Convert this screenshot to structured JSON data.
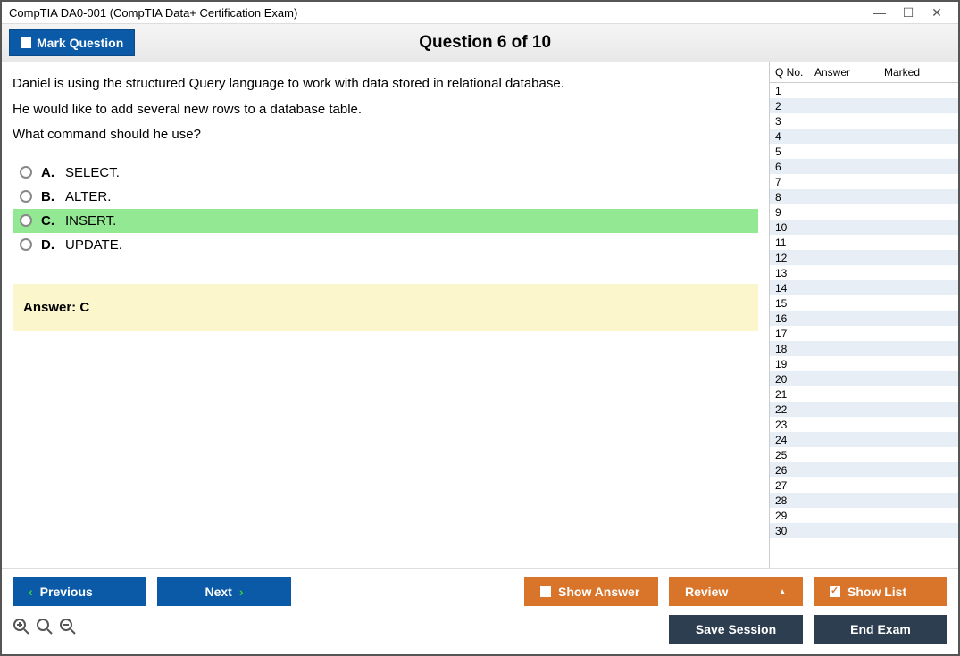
{
  "title": "CompTIA DA0-001 (CompTIA Data+ Certification Exam)",
  "header": {
    "mark_label": "Mark Question",
    "question_title": "Question 6 of 10"
  },
  "question": {
    "text": "Daniel is using the structured Query language to work with data stored in relational database.\nHe would like to add several new rows to a database table.\nWhat command should he use?",
    "options": [
      {
        "letter": "A.",
        "text": "SELECT.",
        "highlighted": false
      },
      {
        "letter": "B.",
        "text": "ALTER.",
        "highlighted": false
      },
      {
        "letter": "C.",
        "text": "INSERT.",
        "highlighted": true
      },
      {
        "letter": "D.",
        "text": "UPDATE.",
        "highlighted": false
      }
    ],
    "answer_label": "Answer: C"
  },
  "side": {
    "col_q": "Q No.",
    "col_a": "Answer",
    "col_m": "Marked"
  },
  "footer": {
    "previous": "Previous",
    "next": "Next",
    "show_answer": "Show Answer",
    "review": "Review",
    "show_list": "Show List",
    "save_session": "Save Session",
    "end_exam": "End Exam"
  }
}
